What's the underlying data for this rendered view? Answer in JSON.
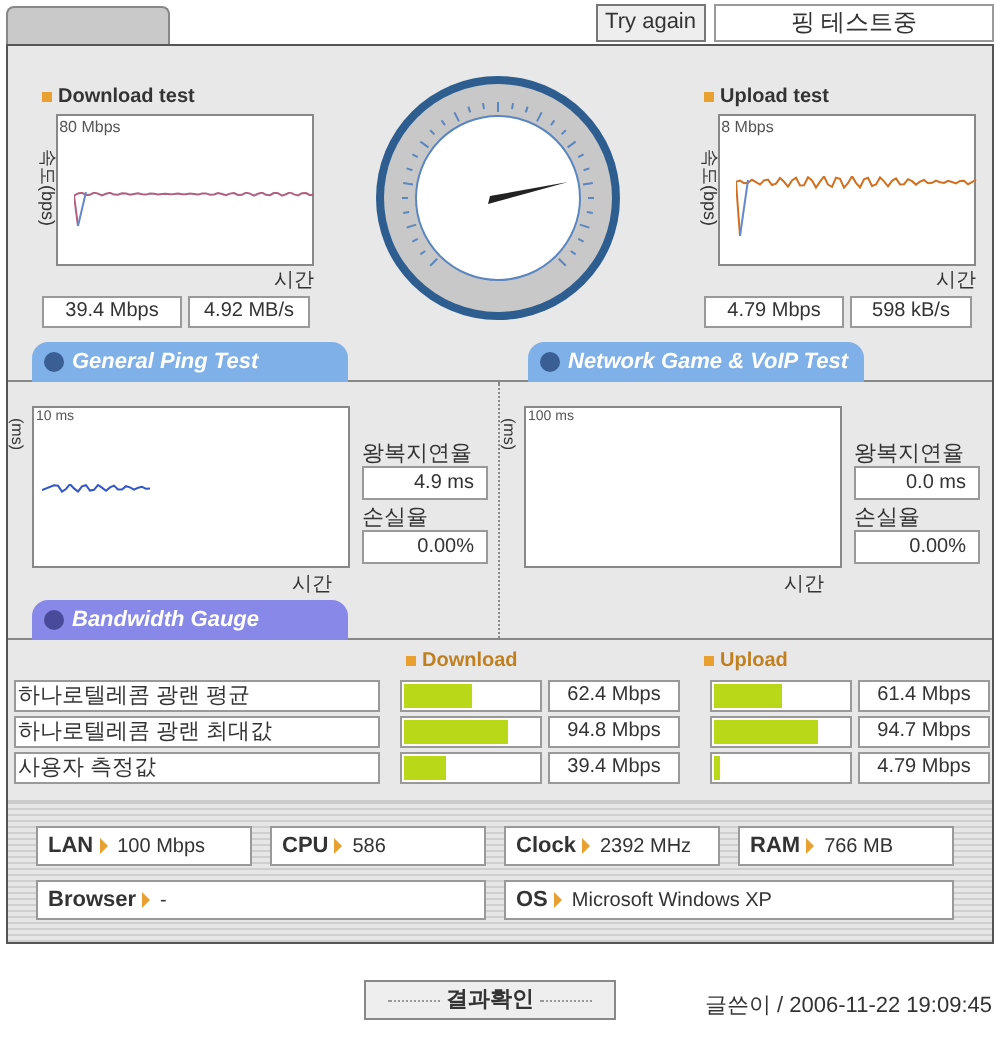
{
  "header": {
    "try_again": "Try again",
    "status": "핑 테스트중"
  },
  "throughput": [
    {
      "title": "Download test",
      "axis_label": "속도(bps)",
      "scale": "80 Mbps",
      "time_label": "시간",
      "readings": [
        "39.4 Mbps",
        "4.92 MB/s"
      ]
    },
    {
      "title": "Upload test",
      "axis_label": "속도(bps)",
      "scale": "8 Mbps",
      "time_label": "시간",
      "readings": [
        "4.79 Mbps",
        "598 kB/s"
      ]
    }
  ],
  "ping_tabs": [
    "General Ping Test",
    "Network Game & VoIP Test"
  ],
  "ping": [
    {
      "axis_label": "(ms)",
      "scale": "10 ms",
      "has_trace": true,
      "time_label": "시간",
      "latency_label": "왕복지연율",
      "latency": "4.9 ms",
      "loss_label": "손실율",
      "loss": "0.00%"
    },
    {
      "axis_label": "(ms)",
      "scale": "100 ms",
      "has_trace": false,
      "time_label": "시간",
      "latency_label": "왕복지연율",
      "latency": "0.0 ms",
      "loss_label": "손실율",
      "loss": "0.00%"
    }
  ],
  "bandwidth": {
    "tab": "Bandwidth Gauge",
    "download_label": "Download",
    "upload_label": "Upload",
    "rows": [
      {
        "name": "하나로텔레콤 광랜 평균",
        "download": {
          "level": 0.5,
          "reading": "62.4 Mbps"
        },
        "upload": {
          "level": 0.5,
          "reading": "61.4 Mbps"
        }
      },
      {
        "name": "하나로텔레콤 광랜 최대값",
        "download": {
          "level": 0.77,
          "reading": "94.8 Mbps"
        },
        "upload": {
          "level": 0.77,
          "reading": "94.7 Mbps"
        }
      },
      {
        "name": "사용자 측정값",
        "download": {
          "level": 0.32,
          "reading": "39.4 Mbps"
        },
        "upload": {
          "level": 0.04,
          "reading": "4.79 Mbps"
        }
      }
    ]
  },
  "system_info": [
    [
      {
        "label": "LAN",
        "value": "100 Mbps"
      },
      {
        "label": "CPU",
        "value": "586"
      },
      {
        "label": "Clock",
        "value": "2392 MHz"
      },
      {
        "label": "RAM",
        "value": "766 MB"
      }
    ],
    [
      {
        "label": "Browser",
        "value": "-"
      },
      {
        "label": "OS",
        "value": "Microsoft Windows XP"
      }
    ]
  ],
  "footer": {
    "button": "결과확인",
    "caption": "글쓴이 / 2006-11-22 19:09:45"
  }
}
